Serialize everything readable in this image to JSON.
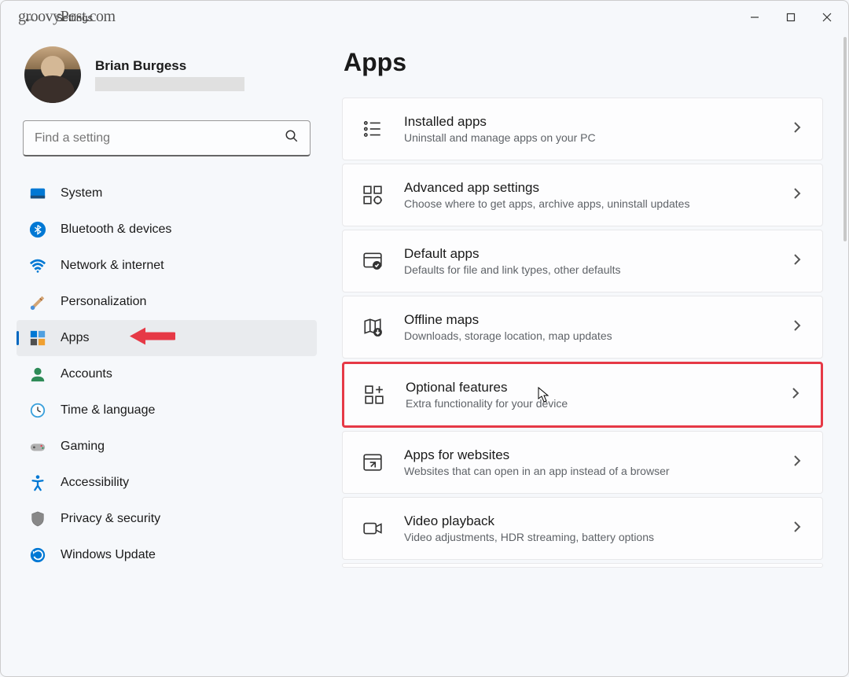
{
  "titlebar": {
    "app_title": "Settings",
    "watermark": "groovyPost.com"
  },
  "profile": {
    "name": "Brian Burgess"
  },
  "search": {
    "placeholder": "Find a setting"
  },
  "nav": {
    "items": [
      {
        "label": "System",
        "icon": "system"
      },
      {
        "label": "Bluetooth & devices",
        "icon": "bluetooth"
      },
      {
        "label": "Network & internet",
        "icon": "network"
      },
      {
        "label": "Personalization",
        "icon": "personalization"
      },
      {
        "label": "Apps",
        "icon": "apps",
        "active": true
      },
      {
        "label": "Accounts",
        "icon": "accounts"
      },
      {
        "label": "Time & language",
        "icon": "time"
      },
      {
        "label": "Gaming",
        "icon": "gaming"
      },
      {
        "label": "Accessibility",
        "icon": "accessibility"
      },
      {
        "label": "Privacy & security",
        "icon": "privacy"
      },
      {
        "label": "Windows Update",
        "icon": "update"
      }
    ]
  },
  "page": {
    "title": "Apps"
  },
  "cards": [
    {
      "title": "Installed apps",
      "desc": "Uninstall and manage apps on your PC",
      "icon": "installed"
    },
    {
      "title": "Advanced app settings",
      "desc": "Choose where to get apps, archive apps, uninstall updates",
      "icon": "advanced"
    },
    {
      "title": "Default apps",
      "desc": "Defaults for file and link types, other defaults",
      "icon": "default"
    },
    {
      "title": "Offline maps",
      "desc": "Downloads, storage location, map updates",
      "icon": "maps"
    },
    {
      "title": "Optional features",
      "desc": "Extra functionality for your device",
      "icon": "optional",
      "highlighted": true
    },
    {
      "title": "Apps for websites",
      "desc": "Websites that can open in an app instead of a browser",
      "icon": "websites"
    },
    {
      "title": "Video playback",
      "desc": "Video adjustments, HDR streaming, battery options",
      "icon": "video"
    }
  ]
}
